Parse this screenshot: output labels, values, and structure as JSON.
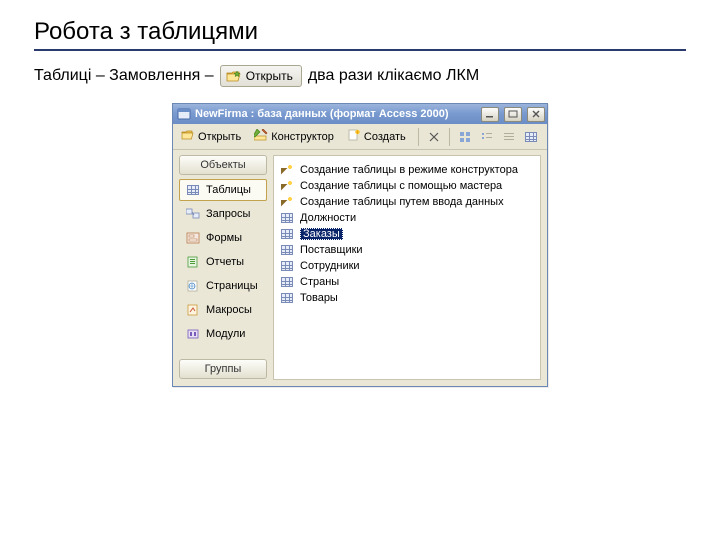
{
  "slide": {
    "title": "Робота з таблицями",
    "instruction_prefix": "Таблиці – Замовлення – ",
    "open_button_label": "Открыть",
    "instruction_suffix": " два рази клікаємо ЛКМ"
  },
  "window": {
    "title": "NewFirma : база данных (формат Access 2000)",
    "toolbar": {
      "open": "Открыть",
      "design": "Конструктор",
      "create": "Создать"
    },
    "sidebar": {
      "objects_header": "Объекты",
      "items": [
        {
          "label": "Таблицы"
        },
        {
          "label": "Запросы"
        },
        {
          "label": "Формы"
        },
        {
          "label": "Отчеты"
        },
        {
          "label": "Страницы"
        },
        {
          "label": "Макросы"
        },
        {
          "label": "Модули"
        }
      ],
      "groups_header": "Группы"
    },
    "list": [
      {
        "label": "Создание таблицы в режиме конструктора",
        "kind": "wizard"
      },
      {
        "label": "Создание таблицы с помощью мастера",
        "kind": "wizard"
      },
      {
        "label": "Создание таблицы путем ввода данных",
        "kind": "wizard"
      },
      {
        "label": "Должности",
        "kind": "table"
      },
      {
        "label": "Заказы",
        "kind": "table",
        "selected": true
      },
      {
        "label": "Поставщики",
        "kind": "table"
      },
      {
        "label": "Сотрудники",
        "kind": "table"
      },
      {
        "label": "Страны",
        "kind": "table"
      },
      {
        "label": "Товары",
        "kind": "table"
      }
    ]
  }
}
